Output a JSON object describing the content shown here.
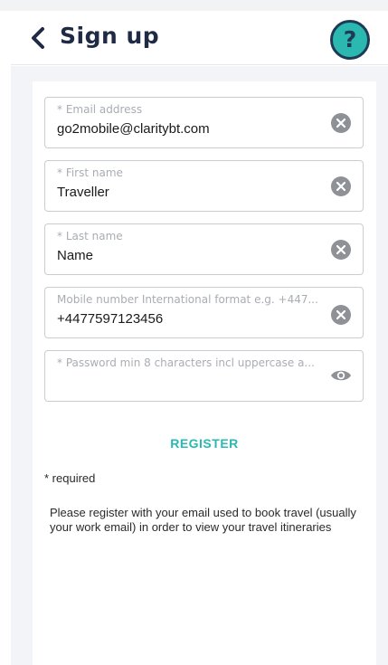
{
  "header": {
    "title": "Sign up",
    "help_label": "?"
  },
  "form": {
    "fields": [
      {
        "label": "* Email address",
        "value": "go2mobile@claritybt.com",
        "action": "clear-icon"
      },
      {
        "label": "* First name",
        "value": "Traveller",
        "action": "clear-icon"
      },
      {
        "label": "* Last name",
        "value": "Name",
        "action": "clear-icon"
      },
      {
        "label": "Mobile number International format e.g. +447...",
        "value": "+4477597123456",
        "action": "clear-icon"
      },
      {
        "label": "* Password min 8 characters incl uppercase a...",
        "value": "",
        "action": "eye-icon"
      }
    ],
    "register_label": "REGISTER",
    "required_note": "* required",
    "info_text": "Please register with your email used to book travel (usually your work email) in order to view your travel itineraries"
  },
  "colors": {
    "accent": "#2bb8b0",
    "navy": "#1f2a44",
    "icon_grey": "#8e9297"
  }
}
